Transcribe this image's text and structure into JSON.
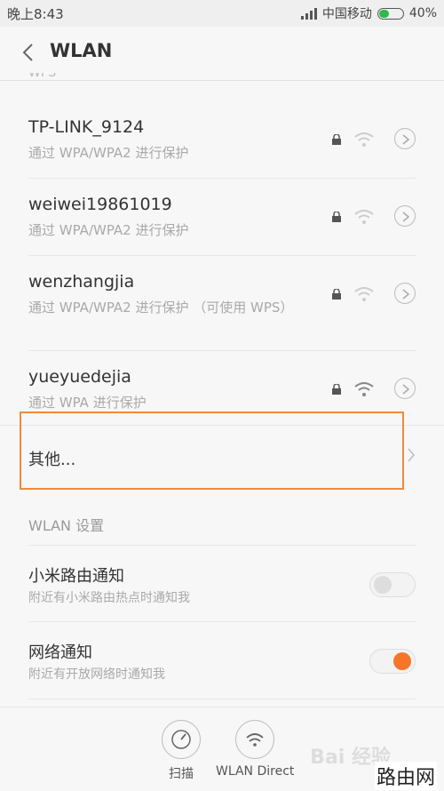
{
  "status_bar": {
    "time": "晚上8:43",
    "carrier": "中国移动",
    "battery": "40%",
    "battery_level": 0.4
  },
  "header": {
    "title": "WLAN"
  },
  "partial_top_text": "WPS",
  "networks": [
    {
      "name": "TP-LINK_9124",
      "security": "通过 WPA/WPA2 进行保护"
    },
    {
      "name": "weiwei19861019",
      "security": "通过 WPA/WPA2 进行保护"
    },
    {
      "name": "wenzhangjia",
      "security": "通过 WPA/WPA2 进行保护 （可使用 WPS）"
    },
    {
      "name": "yueyuedejia",
      "security": "通过 WPA 进行保护"
    }
  ],
  "other": {
    "label": "其他..."
  },
  "settings_section": {
    "label": "WLAN 设置",
    "items": [
      {
        "title": "小米路由通知",
        "subtitle": "附近有小米路由热点时通知我",
        "enabled": false
      },
      {
        "title": "网络通知",
        "subtitle": "附近有开放网络时通知我",
        "enabled": true
      }
    ]
  },
  "bottom_bar": {
    "scan_label": "扫描",
    "direct_label": "WLAN Direct"
  },
  "watermarks": {
    "baidu": "Bai 经验",
    "site": "路由网"
  },
  "colors": {
    "accent": "#f5762a",
    "highlight": "#f08a3c",
    "battery": "#2db84d"
  }
}
